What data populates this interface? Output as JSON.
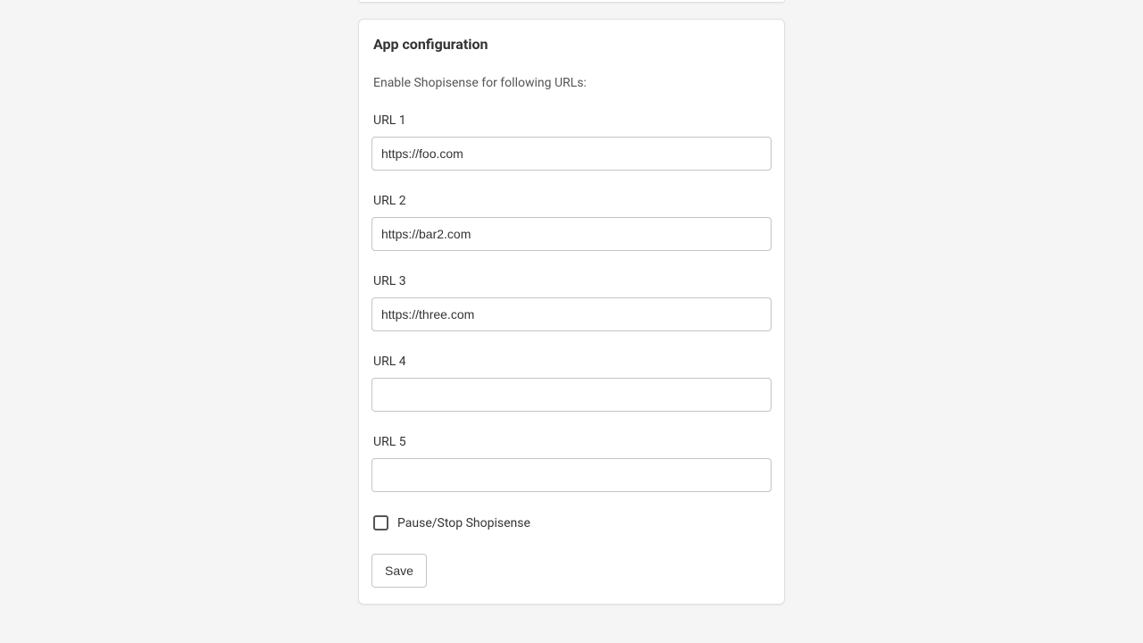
{
  "card": {
    "title": "App configuration",
    "description": "Enable Shopisense for following URLs:",
    "fields": [
      {
        "label": "URL 1",
        "value": "https://foo.com"
      },
      {
        "label": "URL 2",
        "value": "https://bar2.com"
      },
      {
        "label": "URL 3",
        "value": "https://three.com"
      },
      {
        "label": "URL 4",
        "value": ""
      },
      {
        "label": "URL 5",
        "value": ""
      }
    ],
    "checkbox": {
      "label": "Pause/Stop Shopisense",
      "checked": false
    },
    "saveLabel": "Save"
  }
}
